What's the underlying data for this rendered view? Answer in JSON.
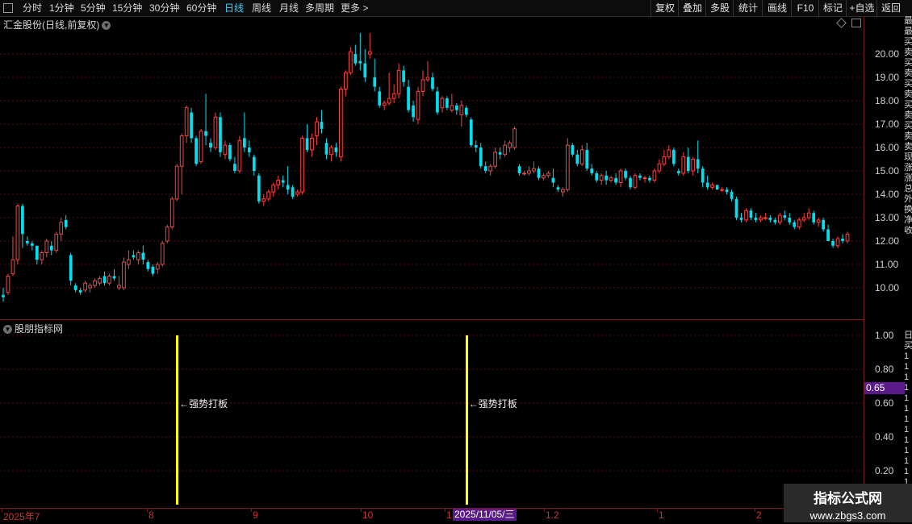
{
  "toolbar": {
    "periods": [
      {
        "label": "分时",
        "active": false
      },
      {
        "label": "1分钟",
        "active": false
      },
      {
        "label": "5分钟",
        "active": false
      },
      {
        "label": "15分钟",
        "active": false
      },
      {
        "label": "30分钟",
        "active": false
      },
      {
        "label": "60分钟",
        "active": false
      },
      {
        "label": "日线",
        "active": true
      },
      {
        "label": "周线",
        "active": false
      },
      {
        "label": "月线",
        "active": false
      },
      {
        "label": "多周期",
        "active": false
      },
      {
        "label": "更多 >",
        "active": false
      }
    ],
    "right_buttons": [
      "复权",
      "叠加",
      "多股",
      "统计",
      "画线",
      "F10",
      "标记",
      "+自选",
      "返回"
    ],
    "active_color": "#2fd5ff"
  },
  "chart_title": "汇金股份(日线,前复权)",
  "indicator_title": "股朋指标网",
  "price_axis": [
    "20.00",
    "19.00",
    "18.00",
    "17.00",
    "16.00",
    "15.00",
    "14.00",
    "13.00",
    "12.00",
    "11.00",
    "10.00"
  ],
  "indicator_axis": [
    "1.00",
    "0.80",
    "0.60",
    "0.40",
    "0.20"
  ],
  "indicator_value_badge": "0.65",
  "x_axis": {
    "labels": [
      "2025年7",
      "8",
      "9",
      "10",
      "1",
      "1.2",
      "1",
      "2"
    ],
    "selected_date": "2025/11/05/三"
  },
  "signals": [
    {
      "label": "←强势打板",
      "candle_index": 36
    },
    {
      "label": "←强势打板",
      "candle_index": 96
    }
  ],
  "right_strip": [
    "最",
    "最",
    "买",
    "卖",
    "买",
    "卖",
    "买",
    "卖",
    "买",
    "卖",
    "买",
    "卖",
    "卖",
    "现",
    "涨",
    "涨",
    "总",
    "外",
    "换",
    "净",
    "收",
    "",
    "",
    "",
    "",
    "",
    "",
    "",
    "",
    "",
    "日",
    "买",
    "1",
    "1",
    "1",
    "1",
    "1",
    "1",
    "1",
    "1",
    "1",
    "1",
    "1",
    "1",
    "1",
    "1",
    "1"
  ],
  "watermark": {
    "line1": "指标公式网",
    "line2": "www.zbgs3.com"
  },
  "colors": {
    "up": "#ff4040",
    "down": "#00e0f0",
    "signal": "#ffff00",
    "grid": "#5a1010",
    "accent": "#5b1a8a"
  },
  "chart_data": {
    "type": "candlestick",
    "title": "汇金股份(日线,前复权)",
    "ylim": [
      9.3,
      21.2
    ],
    "candles": [
      {
        "o": 9.7,
        "h": 10.0,
        "l": 9.4,
        "c": 9.6
      },
      {
        "o": 9.8,
        "h": 10.6,
        "l": 9.7,
        "c": 10.5
      },
      {
        "o": 10.6,
        "h": 12.2,
        "l": 10.5,
        "c": 11.2
      },
      {
        "o": 11.2,
        "h": 13.6,
        "l": 11.0,
        "c": 13.5
      },
      {
        "o": 13.5,
        "h": 13.6,
        "l": 11.7,
        "c": 12.3
      },
      {
        "o": 12.0,
        "h": 12.2,
        "l": 11.8,
        "c": 11.9
      },
      {
        "o": 11.9,
        "h": 12.0,
        "l": 11.6,
        "c": 11.8
      },
      {
        "o": 11.8,
        "h": 11.8,
        "l": 11.0,
        "c": 11.2
      },
      {
        "o": 11.2,
        "h": 11.6,
        "l": 11.0,
        "c": 11.5
      },
      {
        "o": 11.5,
        "h": 12.1,
        "l": 11.3,
        "c": 12.0
      },
      {
        "o": 11.8,
        "h": 12.0,
        "l": 11.4,
        "c": 11.6
      },
      {
        "o": 11.6,
        "h": 12.4,
        "l": 11.5,
        "c": 12.3
      },
      {
        "o": 12.3,
        "h": 13.0,
        "l": 12.0,
        "c": 12.8
      },
      {
        "o": 12.9,
        "h": 13.1,
        "l": 12.5,
        "c": 12.6
      },
      {
        "o": 11.4,
        "h": 11.5,
        "l": 10.1,
        "c": 10.3
      },
      {
        "o": 10.1,
        "h": 10.2,
        "l": 9.8,
        "c": 9.9
      },
      {
        "o": 9.9,
        "h": 10.0,
        "l": 9.7,
        "c": 9.8
      },
      {
        "o": 9.9,
        "h": 10.3,
        "l": 9.8,
        "c": 10.2
      },
      {
        "o": 10.0,
        "h": 10.2,
        "l": 9.8,
        "c": 10.1
      },
      {
        "o": 10.1,
        "h": 10.4,
        "l": 10.0,
        "c": 10.3
      },
      {
        "o": 10.2,
        "h": 10.5,
        "l": 10.1,
        "c": 10.4
      },
      {
        "o": 10.5,
        "h": 10.7,
        "l": 10.1,
        "c": 10.2
      },
      {
        "o": 10.2,
        "h": 10.6,
        "l": 10.1,
        "c": 10.5
      },
      {
        "o": 10.5,
        "h": 10.8,
        "l": 10.3,
        "c": 10.4
      },
      {
        "o": 10.0,
        "h": 10.5,
        "l": 9.9,
        "c": 10.1
      },
      {
        "o": 10.0,
        "h": 11.3,
        "l": 9.9,
        "c": 11.1
      },
      {
        "o": 11.0,
        "h": 11.6,
        "l": 10.8,
        "c": 11.2
      },
      {
        "o": 11.4,
        "h": 11.6,
        "l": 11.2,
        "c": 11.3
      },
      {
        "o": 11.2,
        "h": 11.6,
        "l": 11.0,
        "c": 11.5
      },
      {
        "o": 11.5,
        "h": 11.8,
        "l": 11.0,
        "c": 11.2
      },
      {
        "o": 11.1,
        "h": 11.2,
        "l": 10.7,
        "c": 10.8
      },
      {
        "o": 10.9,
        "h": 11.0,
        "l": 10.5,
        "c": 10.6
      },
      {
        "o": 10.8,
        "h": 11.1,
        "l": 10.6,
        "c": 11.0
      },
      {
        "o": 11.0,
        "h": 12.0,
        "l": 10.9,
        "c": 11.9
      },
      {
        "o": 12.0,
        "h": 12.7,
        "l": 11.9,
        "c": 12.6
      },
      {
        "o": 12.6,
        "h": 13.9,
        "l": 12.5,
        "c": 13.8
      },
      {
        "o": 13.8,
        "h": 15.3,
        "l": 13.7,
        "c": 15.2
      },
      {
        "o": 15.2,
        "h": 16.6,
        "l": 14.0,
        "c": 16.5
      },
      {
        "o": 16.5,
        "h": 17.8,
        "l": 16.2,
        "c": 17.7
      },
      {
        "o": 17.5,
        "h": 17.7,
        "l": 16.2,
        "c": 16.4
      },
      {
        "o": 16.4,
        "h": 16.5,
        "l": 15.2,
        "c": 15.3
      },
      {
        "o": 15.4,
        "h": 16.8,
        "l": 15.3,
        "c": 16.7
      },
      {
        "o": 16.7,
        "h": 18.3,
        "l": 16.1,
        "c": 16.5
      },
      {
        "o": 16.2,
        "h": 16.4,
        "l": 15.8,
        "c": 16.0
      },
      {
        "o": 16.0,
        "h": 17.5,
        "l": 15.9,
        "c": 17.3
      },
      {
        "o": 17.3,
        "h": 17.5,
        "l": 15.6,
        "c": 15.8
      },
      {
        "o": 15.7,
        "h": 16.3,
        "l": 15.5,
        "c": 16.1
      },
      {
        "o": 16.1,
        "h": 16.2,
        "l": 15.4,
        "c": 15.5
      },
      {
        "o": 15.3,
        "h": 15.6,
        "l": 14.9,
        "c": 15.0
      },
      {
        "o": 15.0,
        "h": 16.5,
        "l": 14.9,
        "c": 16.3
      },
      {
        "o": 16.4,
        "h": 17.5,
        "l": 15.8,
        "c": 16.0
      },
      {
        "o": 16.0,
        "h": 16.3,
        "l": 15.6,
        "c": 15.8
      },
      {
        "o": 15.6,
        "h": 15.7,
        "l": 14.8,
        "c": 15.0
      },
      {
        "o": 14.8,
        "h": 14.9,
        "l": 13.6,
        "c": 13.7
      },
      {
        "o": 13.7,
        "h": 14.0,
        "l": 13.5,
        "c": 13.8
      },
      {
        "o": 13.8,
        "h": 14.2,
        "l": 13.7,
        "c": 14.1
      },
      {
        "o": 14.1,
        "h": 14.5,
        "l": 13.9,
        "c": 14.4
      },
      {
        "o": 14.4,
        "h": 14.8,
        "l": 14.2,
        "c": 14.6
      },
      {
        "o": 14.6,
        "h": 14.8,
        "l": 14.3,
        "c": 14.5
      },
      {
        "o": 14.4,
        "h": 15.2,
        "l": 14.0,
        "c": 14.2
      },
      {
        "o": 14.3,
        "h": 14.4,
        "l": 13.8,
        "c": 13.9
      },
      {
        "o": 14.0,
        "h": 14.2,
        "l": 13.9,
        "c": 14.1
      },
      {
        "o": 14.1,
        "h": 16.5,
        "l": 14.0,
        "c": 16.4
      },
      {
        "o": 16.4,
        "h": 17.0,
        "l": 15.8,
        "c": 15.9
      },
      {
        "o": 15.9,
        "h": 16.6,
        "l": 15.6,
        "c": 16.4
      },
      {
        "o": 16.5,
        "h": 17.3,
        "l": 16.1,
        "c": 17.1
      },
      {
        "o": 17.1,
        "h": 17.6,
        "l": 16.6,
        "c": 16.8
      },
      {
        "o": 16.2,
        "h": 16.4,
        "l": 15.5,
        "c": 15.7
      },
      {
        "o": 15.7,
        "h": 16.1,
        "l": 15.4,
        "c": 16.0
      },
      {
        "o": 16.0,
        "h": 16.2,
        "l": 15.6,
        "c": 15.8
      },
      {
        "o": 15.6,
        "h": 18.6,
        "l": 15.4,
        "c": 18.5
      },
      {
        "o": 18.5,
        "h": 19.3,
        "l": 18.2,
        "c": 19.2
      },
      {
        "o": 19.2,
        "h": 20.3,
        "l": 19.1,
        "c": 20.1
      },
      {
        "o": 20.0,
        "h": 20.4,
        "l": 19.5,
        "c": 19.6
      },
      {
        "o": 19.7,
        "h": 20.9,
        "l": 19.3,
        "c": 19.6
      },
      {
        "o": 19.6,
        "h": 20.2,
        "l": 18.8,
        "c": 19.0
      },
      {
        "o": 20.0,
        "h": 20.9,
        "l": 19.8,
        "c": 20.1
      },
      {
        "o": 19.0,
        "h": 19.8,
        "l": 18.4,
        "c": 18.6
      },
      {
        "o": 18.4,
        "h": 18.6,
        "l": 17.7,
        "c": 17.8
      },
      {
        "o": 17.8,
        "h": 18.0,
        "l": 17.6,
        "c": 17.9
      },
      {
        "o": 17.9,
        "h": 19.2,
        "l": 17.8,
        "c": 18.1
      },
      {
        "o": 18.1,
        "h": 18.7,
        "l": 17.9,
        "c": 18.3
      },
      {
        "o": 18.3,
        "h": 19.6,
        "l": 18.1,
        "c": 19.3
      },
      {
        "o": 19.3,
        "h": 19.5,
        "l": 18.6,
        "c": 18.8
      },
      {
        "o": 18.6,
        "h": 18.9,
        "l": 17.5,
        "c": 17.6
      },
      {
        "o": 17.8,
        "h": 18.0,
        "l": 17.1,
        "c": 17.3
      },
      {
        "o": 17.2,
        "h": 18.6,
        "l": 17.0,
        "c": 18.4
      },
      {
        "o": 18.4,
        "h": 19.3,
        "l": 18.2,
        "c": 18.9
      },
      {
        "o": 18.9,
        "h": 19.7,
        "l": 18.8,
        "c": 19.0
      },
      {
        "o": 19.0,
        "h": 19.2,
        "l": 18.4,
        "c": 18.5
      },
      {
        "o": 18.4,
        "h": 18.6,
        "l": 17.4,
        "c": 17.5
      },
      {
        "o": 17.7,
        "h": 18.2,
        "l": 17.5,
        "c": 18.1
      },
      {
        "o": 18.1,
        "h": 18.2,
        "l": 17.6,
        "c": 17.7
      },
      {
        "o": 17.6,
        "h": 18.3,
        "l": 17.5,
        "c": 17.8
      },
      {
        "o": 17.8,
        "h": 17.9,
        "l": 17.4,
        "c": 17.6
      },
      {
        "o": 17.4,
        "h": 18.0,
        "l": 16.9,
        "c": 17.8
      },
      {
        "o": 17.7,
        "h": 17.8,
        "l": 17.3,
        "c": 17.4
      },
      {
        "o": 17.2,
        "h": 17.3,
        "l": 16.0,
        "c": 16.1
      },
      {
        "o": 16.1,
        "h": 16.3,
        "l": 15.8,
        "c": 16.0
      },
      {
        "o": 16.0,
        "h": 16.2,
        "l": 15.1,
        "c": 15.2
      },
      {
        "o": 15.2,
        "h": 15.4,
        "l": 14.9,
        "c": 15.0
      },
      {
        "o": 15.0,
        "h": 15.3,
        "l": 14.8,
        "c": 15.2
      },
      {
        "o": 15.2,
        "h": 16.0,
        "l": 15.1,
        "c": 15.8
      },
      {
        "o": 15.8,
        "h": 16.0,
        "l": 15.5,
        "c": 15.7
      },
      {
        "o": 15.7,
        "h": 16.3,
        "l": 15.6,
        "c": 16.1
      },
      {
        "o": 16.0,
        "h": 16.3,
        "l": 15.8,
        "c": 16.2
      },
      {
        "o": 16.0,
        "h": 16.9,
        "l": 15.9,
        "c": 16.8
      },
      {
        "o": 15.2,
        "h": 15.3,
        "l": 14.8,
        "c": 14.9
      },
      {
        "o": 14.9,
        "h": 15.0,
        "l": 14.8,
        "c": 14.9
      },
      {
        "o": 14.9,
        "h": 15.2,
        "l": 14.8,
        "c": 15.0
      },
      {
        "o": 15.0,
        "h": 15.4,
        "l": 14.9,
        "c": 15.1
      },
      {
        "o": 15.1,
        "h": 15.2,
        "l": 14.6,
        "c": 14.7
      },
      {
        "o": 14.7,
        "h": 14.9,
        "l": 14.6,
        "c": 14.8
      },
      {
        "o": 14.8,
        "h": 15.0,
        "l": 14.7,
        "c": 14.9
      },
      {
        "o": 14.7,
        "h": 15.1,
        "l": 14.3,
        "c": 14.5
      },
      {
        "o": 14.3,
        "h": 14.4,
        "l": 14.1,
        "c": 14.2
      },
      {
        "o": 14.1,
        "h": 14.3,
        "l": 13.9,
        "c": 14.2
      },
      {
        "o": 14.2,
        "h": 16.4,
        "l": 14.1,
        "c": 16.1
      },
      {
        "o": 16.1,
        "h": 16.2,
        "l": 15.6,
        "c": 15.7
      },
      {
        "o": 15.7,
        "h": 15.9,
        "l": 15.2,
        "c": 15.3
      },
      {
        "o": 15.3,
        "h": 16.1,
        "l": 15.2,
        "c": 15.9
      },
      {
        "o": 15.9,
        "h": 16.2,
        "l": 15.0,
        "c": 15.1
      },
      {
        "o": 15.1,
        "h": 15.3,
        "l": 14.8,
        "c": 14.9
      },
      {
        "o": 14.9,
        "h": 15.0,
        "l": 14.5,
        "c": 14.6
      },
      {
        "o": 14.6,
        "h": 14.9,
        "l": 14.4,
        "c": 14.8
      },
      {
        "o": 14.8,
        "h": 15.0,
        "l": 14.4,
        "c": 14.6
      },
      {
        "o": 14.6,
        "h": 14.8,
        "l": 14.5,
        "c": 14.7
      },
      {
        "o": 14.7,
        "h": 14.9,
        "l": 14.4,
        "c": 14.5
      },
      {
        "o": 14.5,
        "h": 15.1,
        "l": 14.3,
        "c": 15.0
      },
      {
        "o": 15.0,
        "h": 15.1,
        "l": 14.6,
        "c": 14.7
      },
      {
        "o": 14.7,
        "h": 14.8,
        "l": 14.2,
        "c": 14.3
      },
      {
        "o": 14.3,
        "h": 14.9,
        "l": 14.2,
        "c": 14.8
      },
      {
        "o": 14.8,
        "h": 14.9,
        "l": 14.6,
        "c": 14.7
      },
      {
        "o": 14.7,
        "h": 14.8,
        "l": 14.5,
        "c": 14.7
      },
      {
        "o": 14.7,
        "h": 14.8,
        "l": 14.5,
        "c": 14.6
      },
      {
        "o": 14.6,
        "h": 15.1,
        "l": 14.5,
        "c": 15.0
      },
      {
        "o": 15.0,
        "h": 15.5,
        "l": 14.9,
        "c": 15.3
      },
      {
        "o": 15.3,
        "h": 15.9,
        "l": 15.2,
        "c": 15.6
      },
      {
        "o": 15.6,
        "h": 16.1,
        "l": 15.5,
        "c": 15.9
      },
      {
        "o": 15.9,
        "h": 16.0,
        "l": 15.2,
        "c": 15.3
      },
      {
        "o": 15.0,
        "h": 15.1,
        "l": 14.8,
        "c": 14.9
      },
      {
        "o": 14.9,
        "h": 15.8,
        "l": 14.8,
        "c": 15.6
      },
      {
        "o": 15.6,
        "h": 16.0,
        "l": 14.9,
        "c": 15.0
      },
      {
        "o": 15.0,
        "h": 15.6,
        "l": 14.8,
        "c": 15.5
      },
      {
        "o": 15.5,
        "h": 16.3,
        "l": 14.9,
        "c": 15.1
      },
      {
        "o": 15.1,
        "h": 15.2,
        "l": 14.3,
        "c": 14.5
      },
      {
        "o": 14.5,
        "h": 14.8,
        "l": 14.2,
        "c": 14.3
      },
      {
        "o": 14.3,
        "h": 14.5,
        "l": 14.2,
        "c": 14.4
      },
      {
        "o": 14.4,
        "h": 14.4,
        "l": 14.2,
        "c": 14.2
      },
      {
        "o": 14.2,
        "h": 14.3,
        "l": 14.1,
        "c": 14.2
      },
      {
        "o": 14.2,
        "h": 14.3,
        "l": 14.0,
        "c": 14.1
      },
      {
        "o": 14.1,
        "h": 14.2,
        "l": 13.7,
        "c": 13.8
      },
      {
        "o": 13.8,
        "h": 13.9,
        "l": 12.9,
        "c": 13.0
      },
      {
        "o": 13.0,
        "h": 13.2,
        "l": 12.8,
        "c": 12.9
      },
      {
        "o": 12.9,
        "h": 13.4,
        "l": 12.8,
        "c": 13.3
      },
      {
        "o": 13.3,
        "h": 13.4,
        "l": 12.9,
        "c": 13.0
      },
      {
        "o": 13.0,
        "h": 13.2,
        "l": 12.8,
        "c": 12.9
      },
      {
        "o": 12.9,
        "h": 13.1,
        "l": 12.8,
        "c": 13.0
      },
      {
        "o": 13.0,
        "h": 13.2,
        "l": 12.9,
        "c": 13.0
      },
      {
        "o": 13.0,
        "h": 13.1,
        "l": 12.8,
        "c": 12.9
      },
      {
        "o": 12.9,
        "h": 13.0,
        "l": 12.7,
        "c": 12.8
      },
      {
        "o": 12.8,
        "h": 13.2,
        "l": 12.7,
        "c": 13.1
      },
      {
        "o": 13.1,
        "h": 13.3,
        "l": 12.9,
        "c": 13.0
      },
      {
        "o": 13.0,
        "h": 13.2,
        "l": 12.7,
        "c": 12.8
      },
      {
        "o": 12.8,
        "h": 12.9,
        "l": 12.5,
        "c": 12.6
      },
      {
        "o": 12.6,
        "h": 13.0,
        "l": 12.5,
        "c": 12.9
      },
      {
        "o": 12.9,
        "h": 13.2,
        "l": 12.8,
        "c": 13.0
      },
      {
        "o": 13.0,
        "h": 13.4,
        "l": 12.9,
        "c": 13.2
      },
      {
        "o": 13.2,
        "h": 13.3,
        "l": 12.7,
        "c": 12.8
      },
      {
        "o": 12.8,
        "h": 13.0,
        "l": 12.6,
        "c": 12.9
      },
      {
        "o": 12.9,
        "h": 13.0,
        "l": 12.4,
        "c": 12.5
      },
      {
        "o": 12.5,
        "h": 12.7,
        "l": 12.0,
        "c": 12.0
      },
      {
        "o": 12.0,
        "h": 12.1,
        "l": 11.7,
        "c": 11.8
      },
      {
        "o": 11.8,
        "h": 12.2,
        "l": 11.7,
        "c": 12.1
      },
      {
        "o": 12.1,
        "h": 12.3,
        "l": 11.9,
        "c": 12.0
      },
      {
        "o": 12.0,
        "h": 12.4,
        "l": 11.9,
        "c": 12.3
      }
    ]
  }
}
